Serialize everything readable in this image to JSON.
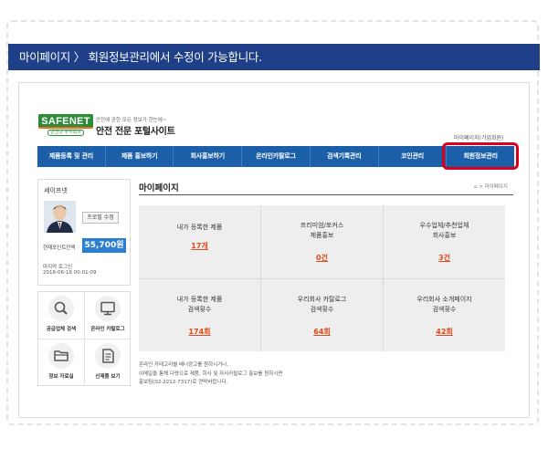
{
  "banner": {
    "text": "마이페이지 〉 회원정보관리에서 수정이 가능합니다."
  },
  "header": {
    "logo_text": "SAFENET",
    "logo_sub": "안전넷 주식회사",
    "tagline": "안전에 관한 모든 정보가 한눈에~",
    "site_title": "안전 전문 포털사이트",
    "user_link": "마이페이지(기업회원)"
  },
  "nav": {
    "items": [
      {
        "label": "제품등록 및 관리"
      },
      {
        "label": "제품 홍보하기"
      },
      {
        "label": "회사홍보하기"
      },
      {
        "label": "온라인카탈로그"
      },
      {
        "label": "검색기록관리"
      },
      {
        "label": "코인관리"
      },
      {
        "label": "회원정보관리"
      }
    ],
    "highlight_color": "#d8001b",
    "bar_color": "#1a5fa8"
  },
  "profile": {
    "name": "세이프넷",
    "edit_label": "프로필 수정",
    "points_label": "현재포인트잔액",
    "points_value": "55,700원",
    "last_login_label": "마지막 로그인",
    "last_login_time": "2016-06-16 00:01:09"
  },
  "quick_menu": {
    "items": [
      {
        "label": "공급업체 검색",
        "icon": "search-icon"
      },
      {
        "label": "온라인 카탈로그",
        "icon": "monitor-icon"
      },
      {
        "label": "정보 자료실",
        "icon": "folder-icon"
      },
      {
        "label": "신제품 보기",
        "icon": "document-icon"
      }
    ]
  },
  "main": {
    "title": "마이페이지",
    "breadcrumb": "> 마이페이지",
    "stats": [
      {
        "label1": "내가 등록한 제품",
        "label2": "",
        "value": "17개"
      },
      {
        "label1": "프리미엄/포커스",
        "label2": "제품홍보",
        "value": "0건"
      },
      {
        "label1": "우수업체/추천업체",
        "label2": "회사홍보",
        "value": "3건"
      },
      {
        "label1": "내가 등록한 제품",
        "label2": "검색횟수",
        "value": "174회"
      },
      {
        "label1": "우리회사 카탈로그",
        "label2": "검색횟수",
        "value": "64회"
      },
      {
        "label1": "우리회사 소개페이지",
        "label2": "검색횟수",
        "value": "42회"
      }
    ],
    "notice": [
      "온라인 카테고리별 배너광고를 원하시거나,",
      "이메일을 통해 다량으로 제품, 회사 및 자사카탈로그 홍보를 원하시면",
      "홍보팀(02-2212-7317)로 연락바랍니다."
    ]
  }
}
